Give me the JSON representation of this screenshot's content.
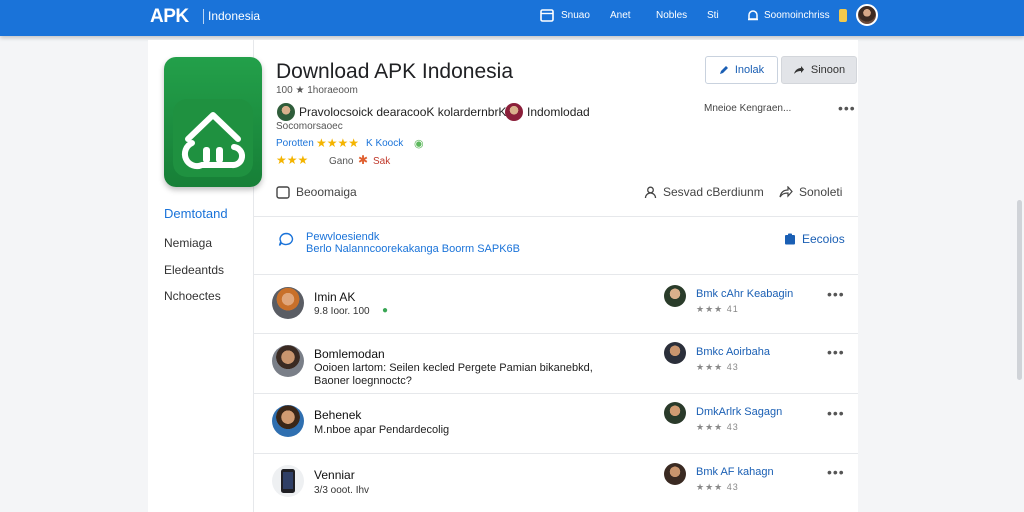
{
  "topbar": {
    "brand": "APK",
    "brand_sub": "Indonesia",
    "nav": [
      "Snuao",
      "Anet",
      "Nobles",
      "Sti"
    ],
    "notifications_label": "Soomoinchriss"
  },
  "sidebar": {
    "items": [
      "Demtotand",
      "Nemiaga",
      "Eledeantds",
      "Nchoectes"
    ]
  },
  "app": {
    "title": "Download APK Indonesia",
    "downloads": "100 ★ 1horaeoom",
    "author_line": "Pravolocsoick dearacooK kolardernbrK",
    "author_tag": "Indomlodad",
    "sub_line": "Socomorsaoec",
    "rating_label": "Porotten",
    "rating_text": "K Koock",
    "rating2_label": "Gano",
    "rating2_text": "Sak",
    "side_note": "Mneioe Kengraen..."
  },
  "buttons": {
    "edit": "Inolak",
    "share": "Sinoon"
  },
  "actions": {
    "left": "Beoomaiga",
    "middle": "Sesvad cBerdiunm",
    "right": "Sonoleti"
  },
  "notice": {
    "title": "Pewvloesiendk",
    "text": "Berlo Nalanncoorekakanga Boorm SAPK6B",
    "button": "Eecoios"
  },
  "reviews": [
    {
      "name": "Imin AK",
      "sub": "9.8 Ioor. 100",
      "right_name": "Bmk cAhr Keabagin",
      "right_stars": "★★★ 41"
    },
    {
      "name": "Bomlemodan",
      "sub": "Ooioen lartom: Seilen kecled Pergete Pamian bikanebkd,",
      "sub2": "Baoner loegnnoctc?",
      "right_name": "Bmkc Aoirbaha",
      "right_stars": "★★★ 43"
    },
    {
      "name": "Behenek",
      "sub": "M.nboe apar Pendardecolig",
      "right_name": "DmkArlrk Sagagn",
      "right_stars": "★★★ 43"
    },
    {
      "name": "Venniar",
      "sub": "3/3 ooot. Ihv",
      "right_name": "Bmk AF kahagn",
      "right_stars": "★★★ 43"
    }
  ],
  "colors": {
    "brand": "#1a73d9",
    "app_green": "#1f9140",
    "star": "#f4b400"
  }
}
